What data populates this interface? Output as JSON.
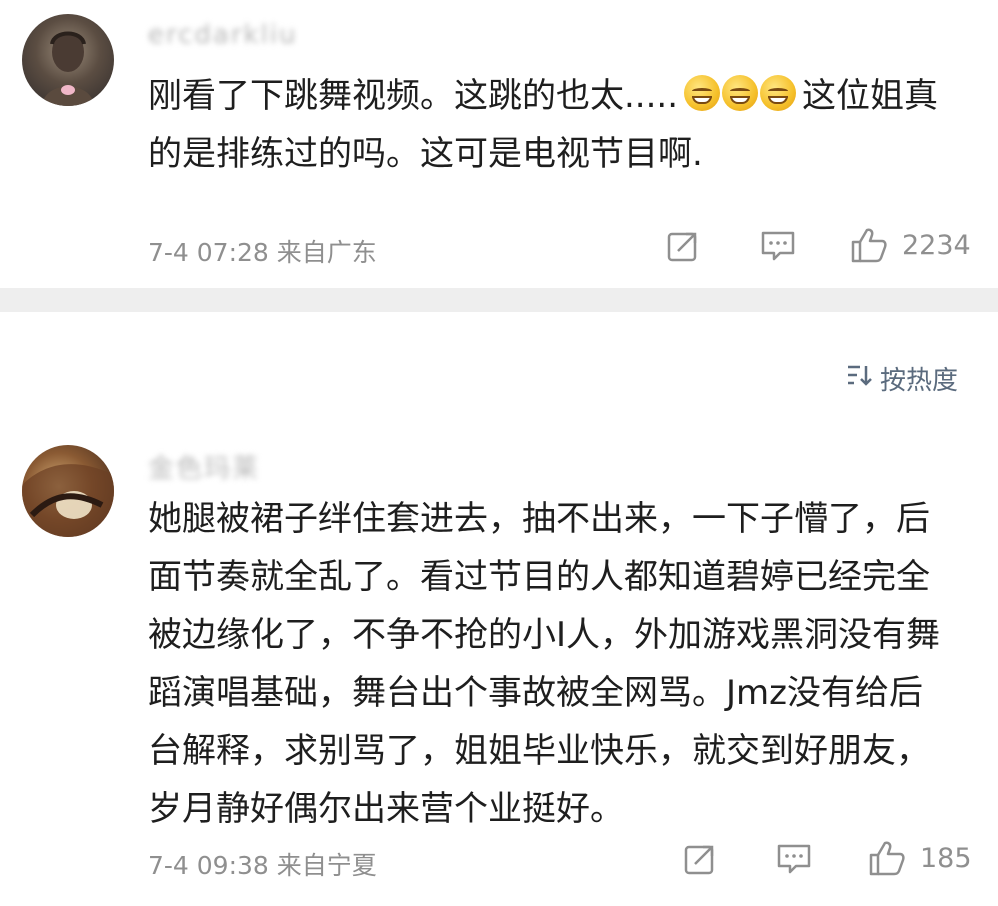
{
  "comments": [
    {
      "username": "ercdarkliu",
      "text_before_emoji": "刚看了下跳舞视频。这跳的也太.....",
      "emoji": "grin-sweat-emoji",
      "text_after_emoji": "这位姐真\n的是排练过的吗。这可是电视节目啊.",
      "time": "7-4 07:28",
      "location": "来自广东",
      "likes": "2234"
    },
    {
      "username": "金色玛莱",
      "text": "她腿被裙子绊住套进去，抽不出来，一下子懵了，后\n面节奏就全乱了。看过节目的人都知道碧婷已经完全\n被边缘化了，不争不抢的小I人，外加游戏黑洞没有舞\n蹈演唱基础，舞台出个事故被全网骂。Jmz没有给后\n台解释，求别骂了，姐姐毕业快乐，就交到好朋友，\n岁月静好偶尔出来营个业挺好。",
      "time": "7-4 09:38",
      "location": "来自宁夏",
      "likes": "185"
    }
  ],
  "sort": {
    "icon": "sort-icon",
    "label": "按热度"
  },
  "icons": {
    "share": "share-icon",
    "comment": "comment-icon",
    "like": "thumbs-up-icon"
  },
  "colors": {
    "meta": "#8f8f8f",
    "sort": "#5b6b7e",
    "divider": "#eeeeee"
  }
}
